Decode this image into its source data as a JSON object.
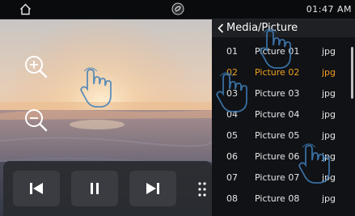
{
  "status": {
    "time": "01:47 AM",
    "home_icon": "home-icon",
    "logo_icon": "brand-logo-icon"
  },
  "photo": {
    "zoom_in_icon": "zoom-in-icon",
    "zoom_out_icon": "zoom-out-icon"
  },
  "controls": {
    "prev_icon": "skip-previous-icon",
    "pause_icon": "pause-icon",
    "next_icon": "skip-next-icon",
    "more_icon": "more-dots-icon"
  },
  "panel": {
    "title": "Media/Picture",
    "back_icon": "chevron-left-icon",
    "items": [
      {
        "num": "01",
        "name": "Picture 01",
        "ext": "jpg",
        "selected": false
      },
      {
        "num": "02",
        "name": "Picture 02",
        "ext": "jpg",
        "selected": true
      },
      {
        "num": "03",
        "name": "Picture 03",
        "ext": "jpg",
        "selected": false
      },
      {
        "num": "04",
        "name": "Picture 04",
        "ext": "jpg",
        "selected": false
      },
      {
        "num": "05",
        "name": "Picture 05",
        "ext": "jpg",
        "selected": false
      },
      {
        "num": "06",
        "name": "Picture 06",
        "ext": "jpg",
        "selected": false
      },
      {
        "num": "07",
        "name": "Picture 07",
        "ext": "jpg",
        "selected": false
      },
      {
        "num": "08",
        "name": "Picture 08",
        "ext": "jpg",
        "selected": false
      }
    ]
  },
  "colors": {
    "selected": "#f0a020",
    "text": "#e6e6e6"
  },
  "gestures": {
    "hand_icon": "touch-hand-icon"
  }
}
